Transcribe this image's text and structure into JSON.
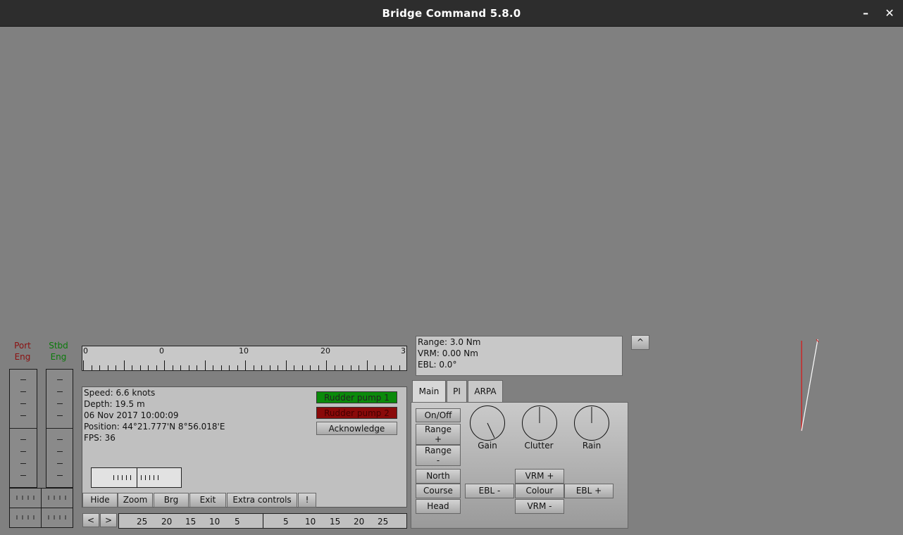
{
  "window": {
    "title": "Bridge Command 5.8.0",
    "minimize_glyph": "–",
    "close_glyph": "✕"
  },
  "engines": {
    "port_label_line1": "Port",
    "port_label_line2": "Eng",
    "stbd_label_line1": "Stbd",
    "stbd_label_line2": "Eng"
  },
  "heading_scale": {
    "labels": [
      "0",
      "0",
      "10",
      "20",
      "3"
    ]
  },
  "info": {
    "speed": "Speed: 6.6 knots",
    "depth": "Depth: 19.5 m",
    "datetime": "06 Nov 2017 10:00:09",
    "position": "Position: 44°21.777'N 8°56.018'E",
    "fps": "FPS: 36"
  },
  "alarms": {
    "pump1": "Rudder pump 1",
    "pump2": "Rudder pump 2",
    "acknowledge": "Acknowledge"
  },
  "toolbar": {
    "hide": "Hide",
    "zoom": "Zoom",
    "brg": "Brg",
    "exit": "Exit",
    "extra_controls": "Extra controls",
    "alert": "!",
    "prev": "<",
    "next": ">"
  },
  "rudder_scale": {
    "labels": [
      "25",
      "20",
      "15",
      "10",
      "5",
      "5",
      "10",
      "15",
      "20",
      "25"
    ]
  },
  "radar_info": {
    "range": "Range: 3.0 Nm",
    "vrm": "VRM: 0.00 Nm",
    "ebl": "EBL: 0.0°",
    "expand": "^"
  },
  "radar_tabs": {
    "main": "Main",
    "pi": "PI",
    "arpa": "ARPA"
  },
  "radar_controls": {
    "on_off": "On/Off",
    "range_plus_1": "Range",
    "range_plus_2": "+",
    "range_minus_1": "Range",
    "range_minus_2": "-",
    "north": "North",
    "course": "Course",
    "head": "Head",
    "ebl_minus": "EBL -",
    "ebl_plus": "EBL +",
    "vrm_plus": "VRM +",
    "colour": "Colour",
    "vrm_minus": "VRM -",
    "gain": "Gain",
    "clutter": "Clutter",
    "rain": "Rain"
  },
  "colors": {
    "port": "#8b1010",
    "starboard": "#0a7a0a",
    "pump_ok": "#0a8a0a",
    "pump_fail": "#8a0a0a",
    "background": "#808080"
  }
}
